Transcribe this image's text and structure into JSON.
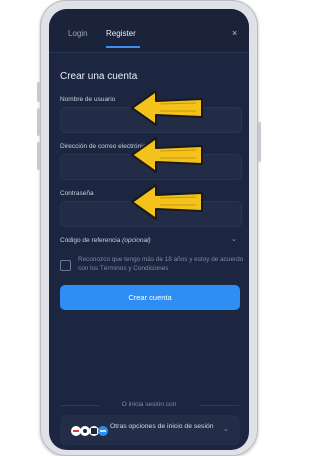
{
  "tabs": {
    "login": "Login",
    "register": "Register"
  },
  "close_icon": "×",
  "title": "Crear una cuenta",
  "fields": {
    "username_label": "Nombre de usuario",
    "email_label": "Dirección de correo electrónico",
    "password_label": "Contraseña"
  },
  "referral": {
    "label": "Código de referencia",
    "optional": "(opcional)"
  },
  "agree_text": "Reconozco que tengo más de 18 años y estoy de acuerdo con los Términos y Condiciones",
  "create_button": "Crear cuenta",
  "or_text": "O inicia sesión con",
  "other_options": "Otras opciones de inicio de sesión",
  "colors": {
    "accent": "#2f8ef4",
    "arrow": "#f3c21b",
    "screen_bg": "#1c2640"
  },
  "icons": [
    "close-icon",
    "chevron-down-icon",
    "arrow-pointer-icon",
    "provider-logos-icon"
  ]
}
